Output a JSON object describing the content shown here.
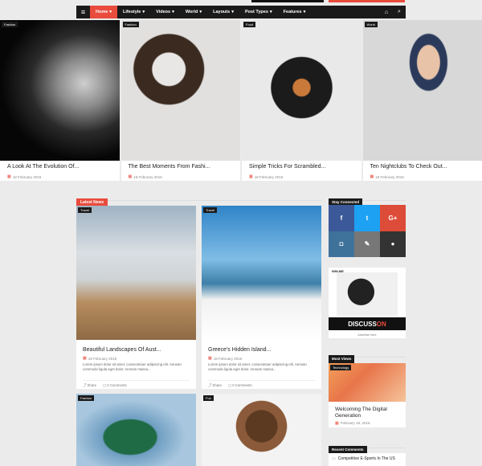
{
  "nav": {
    "items": [
      "Home",
      "Lifestyle",
      "Videos",
      "World",
      "Layouts",
      "Post Types",
      "Features"
    ],
    "active": "Home"
  },
  "hero": [
    {
      "tag": "Fashion",
      "title": "A Look At The Evolution Of...",
      "date": "18 February 2016"
    },
    {
      "tag": "Fashion",
      "title": "The Best Moments From Fashi...",
      "date": "18 February 2016"
    },
    {
      "tag": "Food",
      "title": "Simple Tricks For Scrambled...",
      "date": "18 February 2016"
    },
    {
      "tag": "World",
      "title": "Ten Nightclubs To Check Out...",
      "date": "18 February 2016"
    }
  ],
  "latest": {
    "label": "Latest News",
    "cards": [
      {
        "tag": "Travel",
        "title": "Beautiful Landscapes Of Aust...",
        "date": "18 February 2016",
        "excerpt": "Lorem ipsum dolor sit amet, consectetuer adipiscing elit. Aenean commodo ligula eget dolor. Aenean massa...",
        "share": "Share",
        "comments": "0 Comments"
      },
      {
        "tag": "Travel",
        "title": "Greece's Hidden Island...",
        "date": "18 February 2016",
        "excerpt": "Lorem ipsum dolor sit amet, consectetuer adipiscing elit. Aenean commodo ligula eget dolor. Aenean massa...",
        "share": "Share",
        "comments": "0 Comments"
      },
      {
        "tag": "Fashion"
      },
      {
        "tag": "Fun"
      }
    ]
  },
  "sidebar": {
    "stay_connected": "Stay Connected",
    "social": [
      {
        "icon": "facebook-icon",
        "glyph": "f",
        "color": "#3b5998"
      },
      {
        "icon": "twitter-icon",
        "glyph": "t",
        "color": "#1da1f2"
      },
      {
        "icon": "google-plus-icon",
        "glyph": "G+",
        "color": "#dd4b39"
      },
      {
        "icon": "instagram-icon",
        "glyph": "◘",
        "color": "#3f729b"
      },
      {
        "icon": "edit-icon",
        "glyph": "✎",
        "color": "#777777"
      },
      {
        "icon": "chat-icon",
        "glyph": "●",
        "color": "#333333"
      }
    ],
    "ad": {
      "brand": "WIN.ME",
      "headline_a": "DISCUSS",
      "headline_b": "ON",
      "caption": "Advertise Here"
    },
    "most_views": "Most Views",
    "most_item": {
      "tag": "Technology",
      "title": "Welcoming The Digital Generation",
      "date": "February 18, 2016"
    },
    "recent_comments": "Recent Comments",
    "recent_item": "Competitive E-Sports In The US"
  },
  "colors": {
    "accent": "#e94b3c",
    "dark": "#1a1a1a"
  }
}
